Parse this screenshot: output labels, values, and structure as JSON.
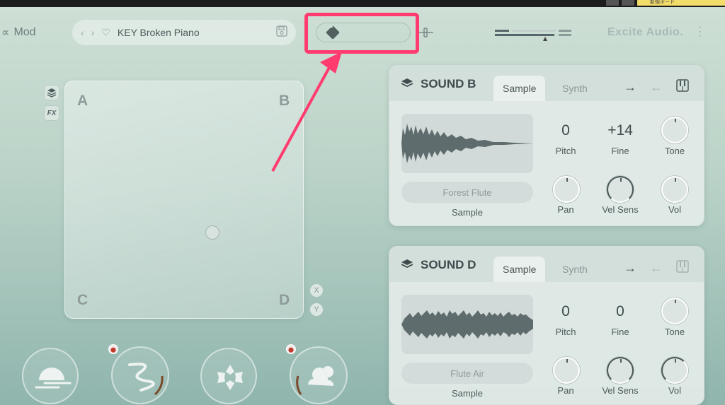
{
  "header": {
    "mod_label": "Mod",
    "mod_icon": "link-icon",
    "preset_name": "KEY Broken Piano",
    "brand": "Excite Audio.",
    "top_strip_text": "新規ボード"
  },
  "xy_pad": {
    "corners": [
      "A",
      "B",
      "C",
      "D"
    ],
    "axes": [
      "X",
      "Y"
    ],
    "side_buttons": [
      "FX"
    ]
  },
  "sound_b": {
    "title": "SOUND B",
    "tabs": [
      "Sample",
      "Synth"
    ],
    "active_tab": "Sample",
    "source_name": "Forest Flute",
    "source_label": "Sample",
    "params": [
      {
        "label": "Pitch",
        "value": "0"
      },
      {
        "label": "Fine",
        "value": "+14"
      },
      {
        "label": "Tone"
      },
      {
        "label": "Pan"
      },
      {
        "label": "Vel Sens"
      },
      {
        "label": "Vol"
      }
    ]
  },
  "sound_d": {
    "title": "SOUND D",
    "tabs": [
      "Sample",
      "Synth"
    ],
    "active_tab": "Sample",
    "source_name": "Flute Air",
    "source_label": "Sample",
    "params": [
      {
        "label": "Pitch",
        "value": "0"
      },
      {
        "label": "Fine",
        "value": "0"
      },
      {
        "label": "Tone"
      },
      {
        "label": "Pan"
      },
      {
        "label": "Vel Sens"
      },
      {
        "label": "Vol"
      }
    ]
  },
  "colors": {
    "highlight": "#ff3b6f",
    "accent_dark": "#4b5858",
    "lamp_red": "#c0392b"
  }
}
